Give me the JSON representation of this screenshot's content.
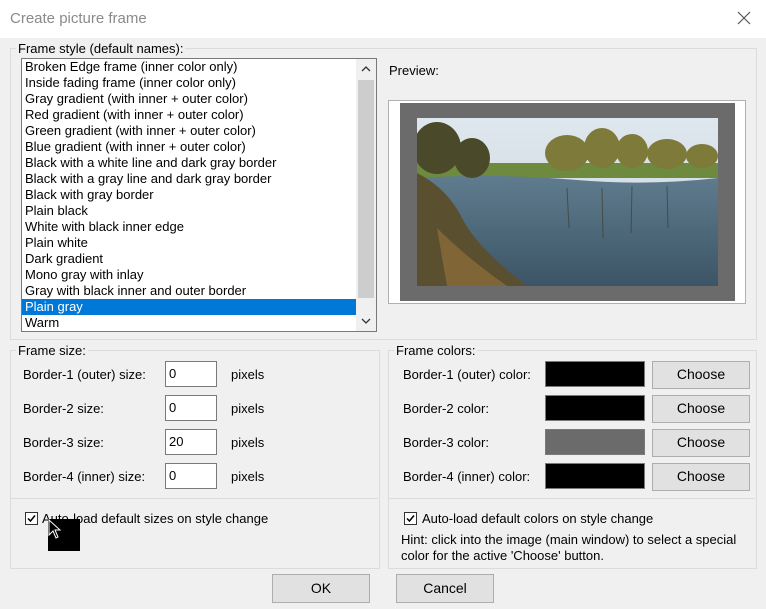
{
  "window": {
    "title": "Create picture frame"
  },
  "frame_style": {
    "label": "Frame style (default names):",
    "items": [
      "Broken Edge frame (inner color only)",
      "Inside fading frame (inner color only)",
      "Gray gradient (with inner + outer color)",
      "Red gradient (with inner + outer color)",
      "Green gradient (with inner + outer color)",
      "Blue gradient (with inner + outer color)",
      "Black with a white line and dark gray border",
      "Black with a gray line and dark gray border",
      "Black with gray border",
      "Plain black",
      "White with black inner edge",
      "Plain white",
      "Dark gradient",
      "Mono gray with inlay",
      "Gray with black inner and outer border",
      "Plain gray",
      "Warm"
    ],
    "selected": "Plain gray"
  },
  "preview": {
    "label": "Preview:",
    "frame_color": "#6b6b6b"
  },
  "frame_size": {
    "label": "Frame size:",
    "rows": [
      {
        "label": "Border-1 (outer) size:",
        "value": "0",
        "unit": "pixels"
      },
      {
        "label": "Border-2 size:",
        "value": "0",
        "unit": "pixels"
      },
      {
        "label": "Border-3 size:",
        "value": "20",
        "unit": "pixels"
      },
      {
        "label": "Border-4 (inner) size:",
        "value": "0",
        "unit": "pixels"
      }
    ],
    "autoload_label": "Auto-load default sizes on style change",
    "autoload_checked": true
  },
  "frame_colors": {
    "label": "Frame colors:",
    "rows": [
      {
        "label": "Border-1 (outer) color:",
        "color": "#000000",
        "button": "Choose"
      },
      {
        "label": "Border-2 color:",
        "color": "#000000",
        "button": "Choose"
      },
      {
        "label": "Border-3 color:",
        "color": "#6b6b6b",
        "button": "Choose"
      },
      {
        "label": "Border-4 (inner) color:",
        "color": "#000000",
        "button": "Choose"
      }
    ],
    "autoload_label": "Auto-load default colors on style change",
    "autoload_checked": true,
    "hint": "Hint: click into the image (main window) to select a special color for the active 'Choose' button."
  },
  "buttons": {
    "ok": "OK",
    "cancel": "Cancel"
  }
}
